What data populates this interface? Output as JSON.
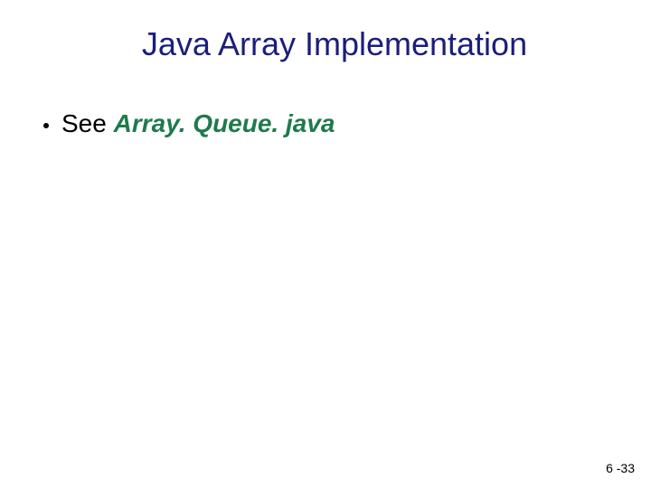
{
  "title": "Java Array Implementation",
  "bullet": {
    "lead": "See ",
    "emphasis": "Array. Queue. java"
  },
  "page_number": "6 -33"
}
